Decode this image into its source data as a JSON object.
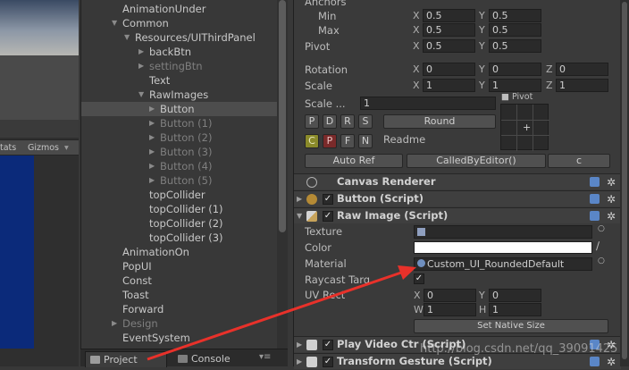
{
  "game_view": {
    "stats_label": "tats",
    "gizmos_label": "Gizmos",
    "gizmos_arrow": "▾"
  },
  "hierarchy": {
    "rows": [
      {
        "label": "AnimationUnder",
        "indent": 0,
        "arrow": ""
      },
      {
        "label": "Common",
        "indent": 0,
        "arrow": "▼"
      },
      {
        "label": "Resources/UIThirdPanel",
        "indent": 1,
        "arrow": "▼"
      },
      {
        "label": "backBtn",
        "indent": 2,
        "arrow": "▶"
      },
      {
        "label": "settingBtn",
        "indent": 2,
        "arrow": "▶",
        "dim": true
      },
      {
        "label": "Text",
        "indent": 2,
        "arrow": ""
      },
      {
        "label": "RawImages",
        "indent": 2,
        "arrow": "▼"
      },
      {
        "label": "Button",
        "indent": 3,
        "arrow": "▶",
        "selected": true
      },
      {
        "label": "Button (1)",
        "indent": 3,
        "arrow": "▶",
        "dim": true
      },
      {
        "label": "Button (2)",
        "indent": 3,
        "arrow": "▶",
        "dim": true
      },
      {
        "label": "Button (3)",
        "indent": 3,
        "arrow": "▶",
        "dim": true
      },
      {
        "label": "Button (4)",
        "indent": 3,
        "arrow": "▶",
        "dim": true
      },
      {
        "label": "Button (5)",
        "indent": 3,
        "arrow": "▶",
        "dim": true
      },
      {
        "label": "topCollider",
        "indent": 2,
        "arrow": ""
      },
      {
        "label": "topCollider (1)",
        "indent": 2,
        "arrow": ""
      },
      {
        "label": "topCollider (2)",
        "indent": 2,
        "arrow": ""
      },
      {
        "label": "topCollider (3)",
        "indent": 2,
        "arrow": ""
      },
      {
        "label": "AnimationOn",
        "indent": 0,
        "arrow": ""
      },
      {
        "label": "PopUI",
        "indent": 0,
        "arrow": ""
      },
      {
        "label": "Const",
        "indent": 0,
        "arrow": ""
      },
      {
        "label": "Toast",
        "indent": 0,
        "arrow": ""
      },
      {
        "label": "Forward",
        "indent": 0,
        "arrow": ""
      },
      {
        "label": "Design",
        "indent": 0,
        "arrow": "▶",
        "dim": true
      },
      {
        "label": "EventSystem",
        "indent": 0,
        "arrow": ""
      }
    ]
  },
  "bottom_tabs": {
    "project": "Project",
    "console": "Console",
    "menu": "▾≡"
  },
  "inspector": {
    "anchors_label": "Anchors",
    "min_label": "Min",
    "max_label": "Max",
    "pivot_label": "Pivot",
    "rotation_label": "Rotation",
    "scale_label": "Scale",
    "x": "X",
    "y": "Y",
    "z": "Z",
    "min": {
      "x": "0.5",
      "y": "0.5"
    },
    "max": {
      "x": "0.5",
      "y": "0.5"
    },
    "pivot": {
      "x": "0.5",
      "y": "0.5"
    },
    "rotation": {
      "x": "0",
      "y": "0",
      "z": "0"
    },
    "scale": {
      "x": "1",
      "y": "1",
      "z": "1"
    },
    "scale_dots_label": "Scale ...",
    "scale_dots_value": "1",
    "pdrs": [
      "P",
      "D",
      "R",
      "S"
    ],
    "round_label": "Round",
    "cpfn": [
      "C",
      "P",
      "F",
      "N"
    ],
    "readme_label": "Readme",
    "pivot_small_label": "■ Pivot",
    "pivot_plus": "+",
    "auto_ref_label": "Auto Ref",
    "called_by_editor_label": "CalledByEditor()",
    "c_label": "c",
    "canvas_renderer": "Canvas Renderer",
    "button_script": "Button (Script)",
    "raw_image_script": "Raw Image (Script)",
    "texture_label": "Texture",
    "color_label": "Color",
    "material_label": "Material",
    "material_value": "Custom_UI_RoundedDefault",
    "raycast_label": "Raycast Targ",
    "uvrect_label": "UV Rect",
    "uv": {
      "x": "0",
      "y": "0",
      "w": "1",
      "h": "1"
    },
    "w": "W",
    "h": "H",
    "set_native_size_label": "Set Native Size",
    "play_video_script": "Play Video Ctr (Script)",
    "transform_gesture_script": "Transform Gesture (Script)",
    "check_mark": "✓",
    "gear_glyph": "✲"
  },
  "watermark": "http://blog.csdn.net/qq_39091425",
  "colors": {
    "arrow": "#e8312a",
    "selection": "#4d4d4d",
    "help_icon": "#5a86c7"
  }
}
